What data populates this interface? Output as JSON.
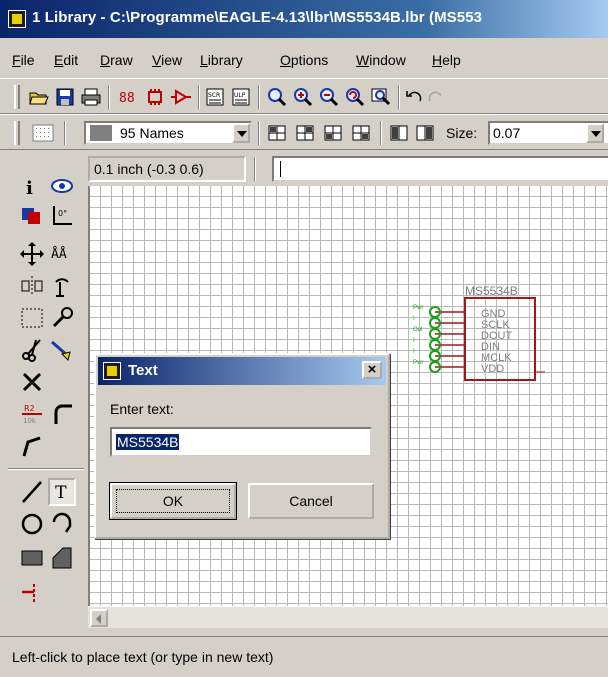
{
  "window": {
    "title": "1 Library - C:\\Programme\\EAGLE-4.13\\lbr\\MS5534B.lbr (MS553"
  },
  "menu": [
    {
      "label": "File",
      "hot": "F",
      "rest": "ile"
    },
    {
      "label": "Edit",
      "hot": "E",
      "rest": "dit"
    },
    {
      "label": "Draw",
      "hot": "D",
      "rest": "raw"
    },
    {
      "label": "View",
      "hot": "V",
      "rest": "iew"
    },
    {
      "label": "Library",
      "hot": "L",
      "rest": "ibrary"
    },
    {
      "label": "Options",
      "hot": "O",
      "rest": "ptions"
    },
    {
      "label": "Window",
      "hot": "W",
      "rest": "indow"
    },
    {
      "label": "Help",
      "hot": "H",
      "rest": "elp"
    }
  ],
  "layer": {
    "value": "95 Names"
  },
  "size": {
    "label": "Size:",
    "value": "0.07"
  },
  "coordinates": "0.1 inch (-0.3 0.6)",
  "symbol": {
    "name": "MS5534B",
    "pins": [
      "GND",
      "SCLK",
      "DOUT",
      "DIN",
      "MCLK",
      "VDD"
    ],
    "pin_tags": [
      "Pwr",
      "I",
      "Out",
      "I",
      "I",
      "Pwr"
    ],
    "color": "#a01818",
    "pin_color": "#18a018"
  },
  "dialog": {
    "title": "Text",
    "prompt": "Enter text:",
    "value": "MS5534B",
    "ok_label": "OK",
    "cancel_label": "Cancel",
    "close_glyph": "×"
  },
  "status": "Left-click to place text (or type in new text)",
  "colors": {
    "titlebar": "#0a246a",
    "canvas_bg": "#ffffff",
    "grid": "#b8b8b8"
  }
}
